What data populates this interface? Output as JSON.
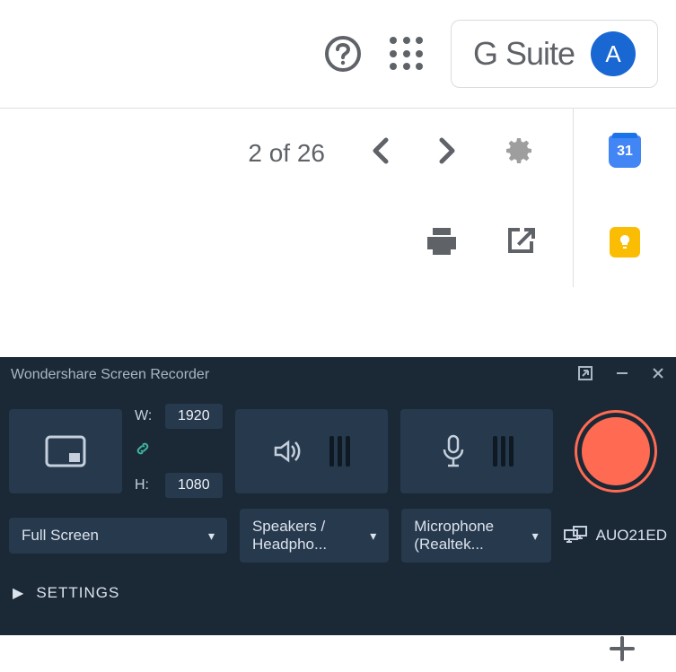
{
  "gmail": {
    "gsuite_label": "G Suite",
    "avatar_letter": "A",
    "pager": "2 of 26",
    "calendar_day": "31"
  },
  "recorder": {
    "title": "Wondershare Screen Recorder",
    "width_label": "W:",
    "width_value": "1920",
    "height_label": "H:",
    "height_value": "1080",
    "screen_mode": "Full Screen",
    "audio_device": "Speakers / Headpho...",
    "mic_device": "Microphone (Realtek...",
    "display_device": "AUO21ED",
    "settings_label": "SETTINGS"
  }
}
